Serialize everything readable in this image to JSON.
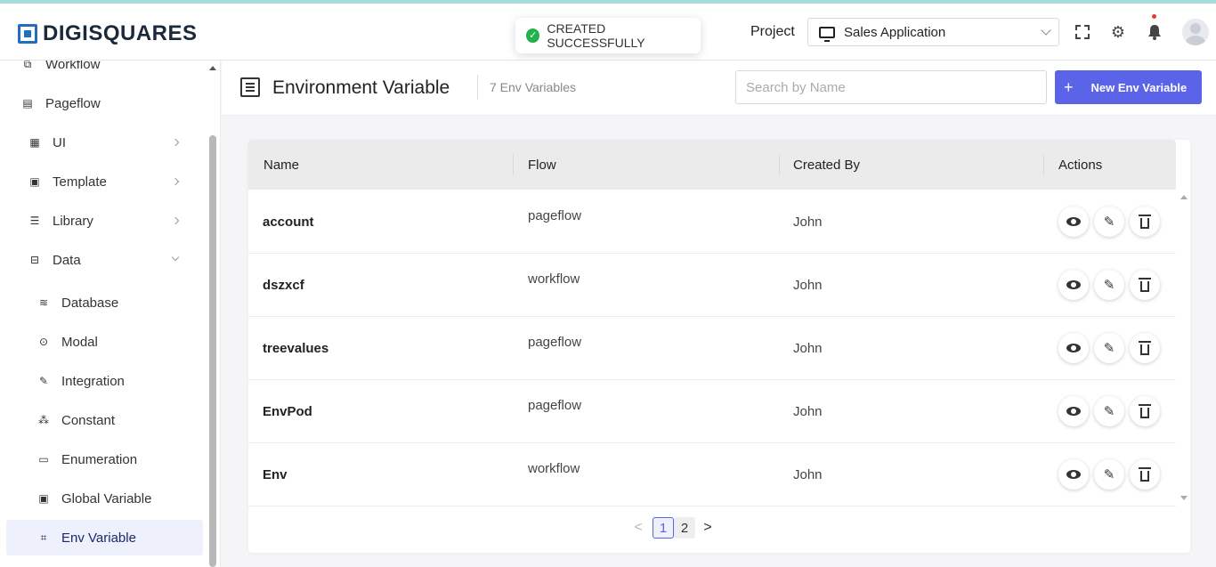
{
  "header": {
    "brand": "DIGISQUARES",
    "toast": "CREATED SUCCESSFULLY",
    "project_label": "Project",
    "project_value": "Sales Application"
  },
  "sidebar": {
    "items": [
      {
        "label": "Workflow",
        "icon": "workflow-icon"
      },
      {
        "label": "Pageflow",
        "icon": "pageflow-icon"
      },
      {
        "label": "UI",
        "icon": "ui-icon"
      },
      {
        "label": "Template",
        "icon": "template-icon"
      },
      {
        "label": "Library",
        "icon": "library-icon"
      },
      {
        "label": "Data",
        "icon": "data-icon"
      },
      {
        "label": "Database",
        "icon": "database-icon"
      },
      {
        "label": "Modal",
        "icon": "modal-icon"
      },
      {
        "label": "Integration",
        "icon": "integration-icon"
      },
      {
        "label": "Constant",
        "icon": "constant-icon"
      },
      {
        "label": "Enumeration",
        "icon": "enumeration-icon"
      },
      {
        "label": "Global Variable",
        "icon": "global-variable-icon"
      },
      {
        "label": "Env Variable",
        "icon": "env-variable-icon"
      }
    ],
    "active": "Env Variable"
  },
  "page": {
    "title": "Environment Variable",
    "count": "7 Env Variables",
    "search_placeholder": "Search by Name",
    "new_button": "New Env Variable",
    "new_button_icon": "+"
  },
  "table": {
    "columns": [
      "Name",
      "Flow",
      "Created By",
      "Actions"
    ],
    "rows": [
      {
        "name": "account",
        "flow": "pageflow",
        "created_by": "John"
      },
      {
        "name": "dszxcf",
        "flow": "workflow",
        "created_by": "John"
      },
      {
        "name": "treevalues",
        "flow": "pageflow",
        "created_by": "John"
      },
      {
        "name": "EnvPod",
        "flow": "pageflow",
        "created_by": "John"
      },
      {
        "name": "Env",
        "flow": "workflow",
        "created_by": "John"
      }
    ]
  },
  "pagination": {
    "prev": "<",
    "pages": [
      "1",
      "2"
    ],
    "current": "1",
    "next": ">"
  },
  "colors": {
    "accent": "#5b63e8",
    "success": "#22b24c",
    "brand": "#1f6fbf",
    "notification": "#e53935"
  }
}
